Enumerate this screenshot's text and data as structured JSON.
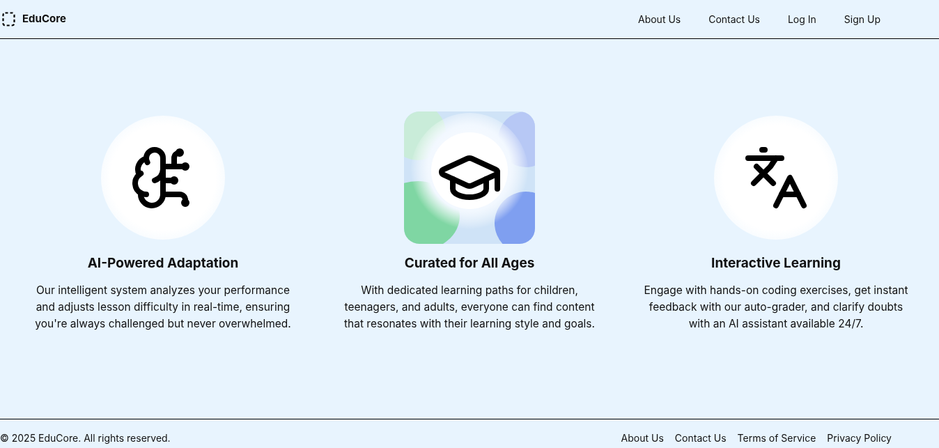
{
  "header": {
    "brand": "EduCore",
    "nav": [
      "About Us",
      "Contact Us",
      "Log In",
      "Sign Up"
    ]
  },
  "features": [
    {
      "kind": "brain",
      "title": "AI-Powered Adaptation",
      "text": "Our intelligent system analyzes your performance and adjusts lesson difficulty in real-time, ensuring you're always challenged but never overwhelmed."
    },
    {
      "kind": "cap",
      "title": "Curated for All Ages",
      "text": "With dedicated learning paths for children, teenagers, and adults, everyone can find content that resonates with their learning style and goals."
    },
    {
      "kind": "translate",
      "title": "Interactive Learning",
      "text": "Engage with hands-on coding exercises, get instant feedback with our auto-grader, and clarify doubts with an AI assistant available 24/7."
    }
  ],
  "footer": {
    "copyright": "© 2025 EduCore. All rights reserved.",
    "links": [
      "About Us",
      "Contact Us",
      "Terms of Service",
      "Privacy Policy"
    ]
  }
}
